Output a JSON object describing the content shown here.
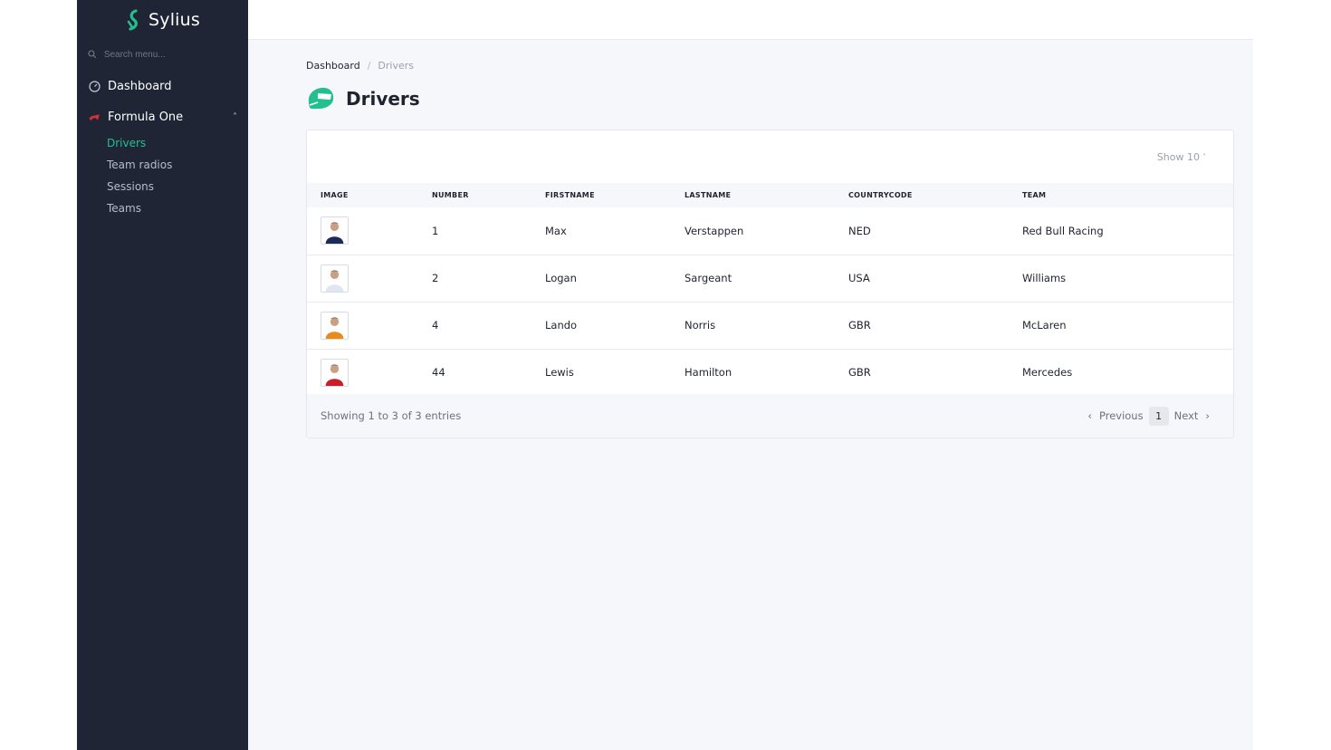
{
  "brand": {
    "name": "Sylius"
  },
  "sidebar": {
    "search_placeholder": "Search menu...",
    "items": [
      {
        "label": "Dashboard",
        "icon": "dashboard-icon"
      },
      {
        "label": "Formula One",
        "icon": "f1-car-icon",
        "expanded": true,
        "children": [
          {
            "label": "Drivers",
            "active": true
          },
          {
            "label": "Team radios"
          },
          {
            "label": "Sessions"
          },
          {
            "label": "Teams"
          }
        ]
      }
    ]
  },
  "breadcrumb": {
    "home": "Dashboard",
    "separator": "/",
    "current": "Drivers"
  },
  "page": {
    "title": "Drivers",
    "icon": "helmet-icon"
  },
  "toolbar": {
    "show_label": "Show 10"
  },
  "table": {
    "columns": [
      "IMAGE",
      "NUMBER",
      "FIRSTNAME",
      "LASTNAME",
      "COUNTRYCODE",
      "TEAM"
    ],
    "rows": [
      {
        "number": "1",
        "firstname": "Max",
        "lastname": "Verstappen",
        "countrycode": "NED",
        "team": "Red Bull Racing",
        "suit_color": "#1e2a5a"
      },
      {
        "number": "2",
        "firstname": "Logan",
        "lastname": "Sargeant",
        "countrycode": "USA",
        "team": "Williams",
        "suit_color": "#dfe6f0"
      },
      {
        "number": "4",
        "firstname": "Lando",
        "lastname": "Norris",
        "countrycode": "GBR",
        "team": "McLaren",
        "suit_color": "#e98a1f"
      },
      {
        "number": "44",
        "firstname": "Lewis",
        "lastname": "Hamilton",
        "countrycode": "GBR",
        "team": "Mercedes",
        "suit_color": "#c8202a"
      }
    ]
  },
  "footer": {
    "entries_text": "Showing 1 to 3 of 3 entries",
    "previous_label": "Previous",
    "next_label": "Next",
    "current_page": "1"
  },
  "colors": {
    "accent": "#22c08f",
    "sidebar_bg": "#1f2535"
  }
}
